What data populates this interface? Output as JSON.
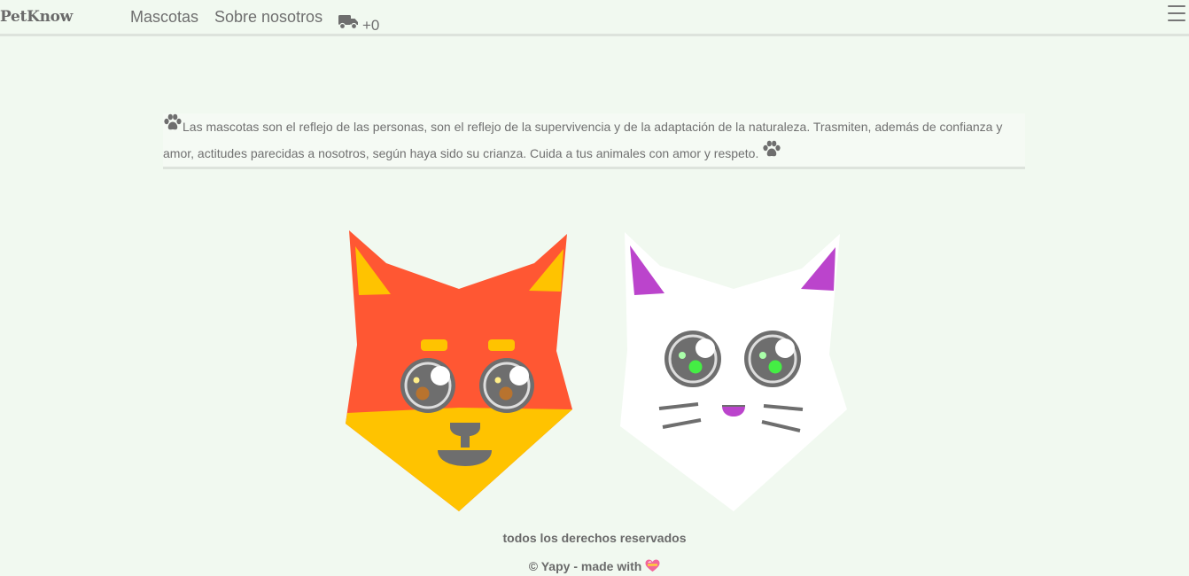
{
  "nav": {
    "brand": "PetKnow",
    "links": [
      "Mascotas",
      "Sobre nosotros"
    ],
    "cart_icon": "truck-icon",
    "cart_count": "+0",
    "menu_icon": "hamburger-menu-icon"
  },
  "quote": {
    "text": "Las mascotas son el reflejo de las personas, son el reflejo de la supervivencia y de la adaptación de la naturaleza. Trasmiten, además de confianza y amor, actitudes parecidas a nosotros, según haya sido su crianza. Cuida a tus animales con amor y respeto.",
    "icon": "paw-icon"
  },
  "illustration": {
    "cats": [
      "orange-cat",
      "white-cat"
    ],
    "colors": {
      "orange": "#ff5733",
      "yellow": "#ffc300",
      "white": "#ffffff",
      "purple": "#bb44cc",
      "gray": "#6e6e6e",
      "green": "#44ee44",
      "brown": "#b8732e"
    }
  },
  "footer": {
    "rights": "todos los derechos reservados",
    "credit": "© Yapy - made with",
    "heart_icon": "heart-icon"
  }
}
